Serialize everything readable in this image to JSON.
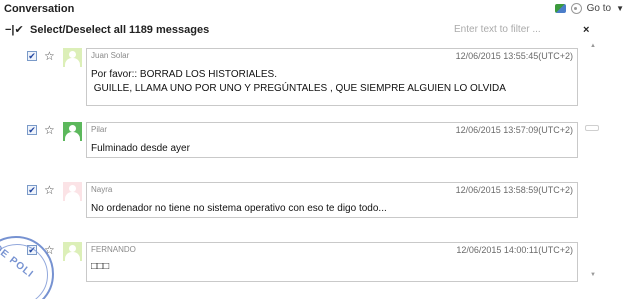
{
  "header": {
    "title": "Conversation",
    "goto_label": "Go to",
    "message_icon": "message-icon",
    "settings_icon": "gear-icon"
  },
  "selection": {
    "marker": "−|✔",
    "label": "Select/Deselect all 1189 messages",
    "filter_placeholder": "Enter text to filter ...",
    "clear_label": "×"
  },
  "messages": [
    {
      "sender": "Juan Solar",
      "timestamp": "12/06/2015 13:55:45(UTC+2)",
      "line1": "Por favor:: BORRAD LOS HISTORIALES.",
      "line2": " GUILLE, LLAMA UNO POR UNO Y PREGÚNTALES , QUE SIEMPRE ALGUIEN LO OLVIDA",
      "checked": "✔",
      "star": "☆",
      "avatar_color": "#dcefb8"
    },
    {
      "sender": "Pilar",
      "timestamp": "12/06/2015 13:57:09(UTC+2)",
      "line1": "Fulminado desde ayer",
      "checked": "✔",
      "star": "☆",
      "avatar_color": "#5cb85c"
    },
    {
      "sender": "Nayra",
      "timestamp": "12/06/2015 13:58:59(UTC+2)",
      "line1": "No ordenador no tiene no sistema operativo con eso te digo todo...",
      "checked": "✔",
      "star": "☆",
      "avatar_color": "#fbe3e6"
    },
    {
      "sender": "FERNANDO",
      "timestamp": "12/06/2015 14:00:11(UTC+2)",
      "line1": "□□□",
      "checked": "✔",
      "star": "☆",
      "avatar_color": "#dcefb8"
    }
  ],
  "stamp": {
    "text": "DE POLI"
  },
  "colors": {
    "bubble_border": "#c9c9c9",
    "checkbox_check": "#2246a0",
    "stamp": "#5f7fc9"
  }
}
